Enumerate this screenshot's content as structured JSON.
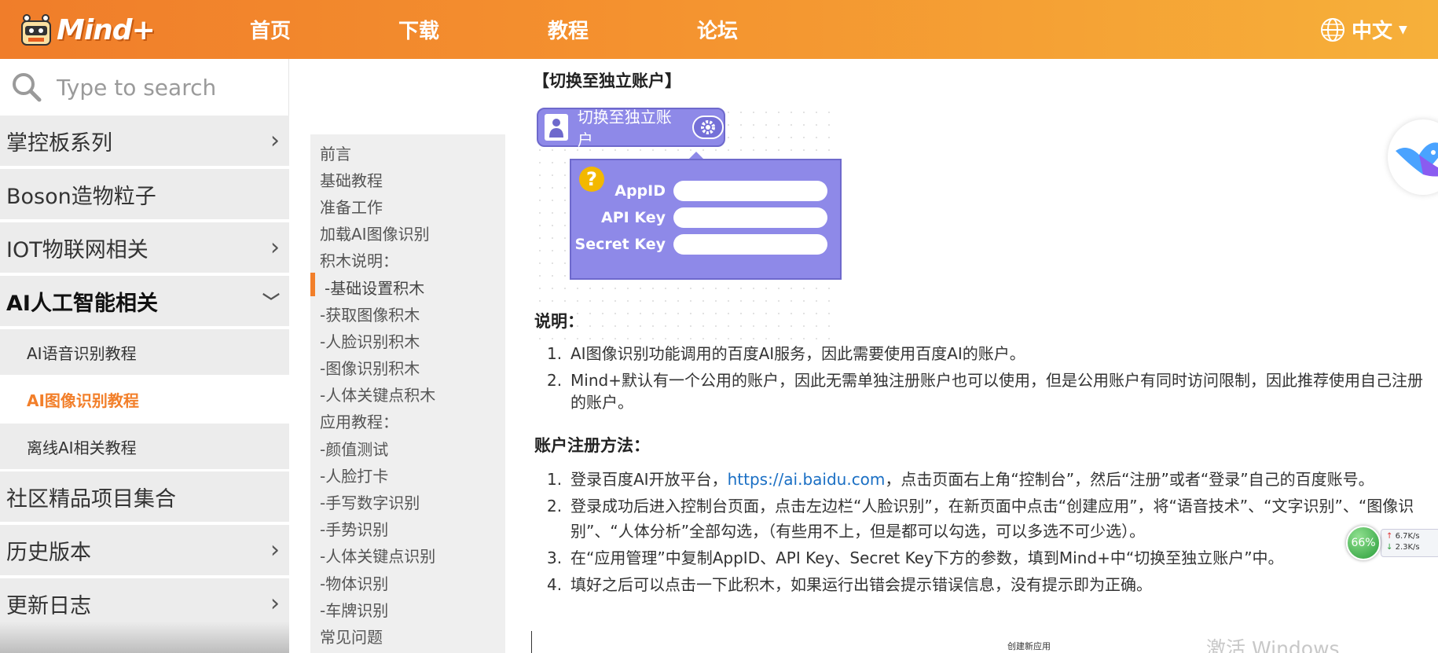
{
  "header": {
    "logo_text": "Mind+",
    "nav": [
      "首页",
      "下载",
      "教程",
      "论坛"
    ],
    "language": "中文",
    "colors": {
      "bar_start": "#f07d2a",
      "bar_end": "#f6b03a"
    }
  },
  "sidebar": {
    "search_placeholder": "Type to search",
    "items": [
      {
        "label": "掌控板系列",
        "expandable": true
      },
      {
        "label": "Boson造物粒子",
        "expandable": false
      },
      {
        "label": "IOT物联网相关",
        "expandable": true
      },
      {
        "label": "AI人工智能相关",
        "expandable": true,
        "open": true
      },
      {
        "label": "社区精品项目集合",
        "expandable": false
      },
      {
        "label": "历史版本",
        "expandable": true
      },
      {
        "label": "更新日志",
        "expandable": true
      }
    ],
    "sub_items": [
      {
        "label": "AI语音识别教程"
      },
      {
        "label": "AI图像识别教程",
        "active": true
      },
      {
        "label": "离线AI相关教程"
      }
    ],
    "accent_color": "#f27f2a"
  },
  "toc": {
    "items": [
      "前言",
      "基础教程",
      "准备工作",
      "加载AI图像识别",
      "积木说明：",
      "-基础设置积木",
      "-获取图像积木",
      "-人脸识别积木",
      "-图像识别积木",
      "-人体关键点积木",
      "应用教程：",
      "-颜值测试",
      "-人脸打卡",
      "-手写数字识别",
      "-手势识别",
      "-人体关键点识别",
      "-物体识别",
      "-车牌识别",
      "常见问题"
    ],
    "current_index": 5
  },
  "content": {
    "section_title": "【切换至独立账户】",
    "block": {
      "label": "切换至独立账户",
      "fields": [
        "AppID",
        "API Key",
        "Secret Key"
      ],
      "help_glyph": "?",
      "color": "#8e89e8"
    },
    "notes_title": "说明：",
    "notes": [
      "AI图像识别功能调用的百度AI服务，因此需要使用百度AI的账户。",
      "Mind+默认有一个公用的账户，因此无需单独注册账户也可以使用，但是公用账户有同时访问限制，因此推荐使用自己注册",
      "的账户。"
    ],
    "register_title": "账户注册方法：",
    "steps": {
      "s1_before": "登录百度AI开放平台，",
      "s1_link": "https://ai.baidu.com",
      "s1_after": "，点击页面右上角“控制台”，然后“注册”或者“登录”自己的百度账号。",
      "s2_line1": "登录成功后进入控制台页面，点击左边栏“人脸识别”，在新页面中点击“创建应用”，将“语音技术”、“文字识别”、“图像识",
      "s2_line2": "别”、“人体分析”全部勾选，（有些用不上，但是都可以勾选，可以多选不可少选）。",
      "s3": "在“应用管理”中复制AppID、API Key、Secret Key下方的参数，填到Mind+中“切换至独立账户”中。",
      "s4": "填好之后可以点击一下此积木，如果运行出错会提示错误信息，没有提示即为正确。"
    },
    "nums": [
      "1.",
      "2.",
      "3.",
      "4."
    ],
    "thumb_caption": "创建新应用"
  },
  "overlays": {
    "net_percent": "66%",
    "net_up": "6.7K/s",
    "net_down": "2.3K/s",
    "watermark": "激活 Windows"
  }
}
